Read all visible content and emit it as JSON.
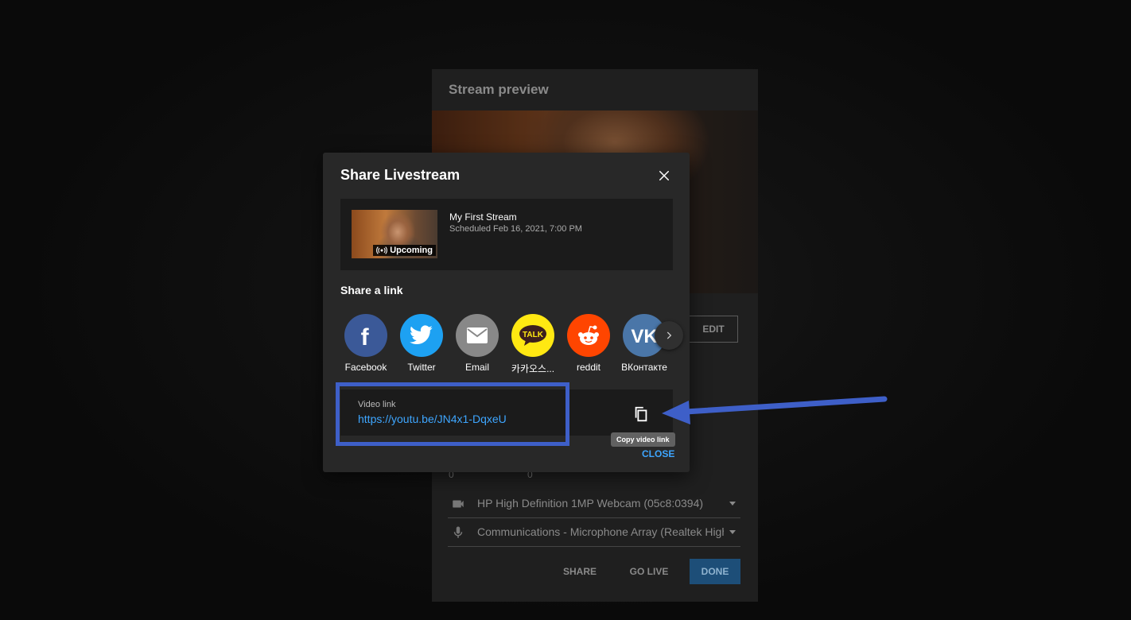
{
  "studio": {
    "title": "Stream preview",
    "edit_label": "EDIT",
    "stat_left": "0",
    "stat_right": "0",
    "camera": "HP High Definition 1MP Webcam (05c8:0394)",
    "microphone": "Communications - Microphone Array (Realtek High Definition Audio)",
    "share_label": "SHARE",
    "golive_label": "GO LIVE",
    "done_label": "DONE"
  },
  "dialog": {
    "title": "Share Livestream",
    "stream": {
      "title": "My First Stream",
      "scheduled": "Scheduled Feb 16, 2021, 7:00 PM",
      "badge": "Upcoming"
    },
    "share_heading": "Share a link",
    "share_targets": [
      {
        "label": "Facebook",
        "icon": "facebook-icon",
        "color": "#3b5998"
      },
      {
        "label": "Twitter",
        "icon": "twitter-icon",
        "color": "#1da1f2"
      },
      {
        "label": "Email",
        "icon": "email-icon",
        "color": "#888888"
      },
      {
        "label": "카카오스...",
        "icon": "kakaotalk-icon",
        "color": "#ffe812"
      },
      {
        "label": "reddit",
        "icon": "reddit-icon",
        "color": "#ff4500"
      },
      {
        "label": "ВКонтакте",
        "icon": "vk-icon",
        "color": "#4a76a8"
      }
    ],
    "video_link_label": "Video link",
    "video_link_url": "https://youtu.be/JN4x1-DqxeU",
    "copy_tooltip": "Copy video link",
    "close_label": "CLOSE"
  },
  "annotation": {
    "highlight_color": "#3e5fc8"
  }
}
